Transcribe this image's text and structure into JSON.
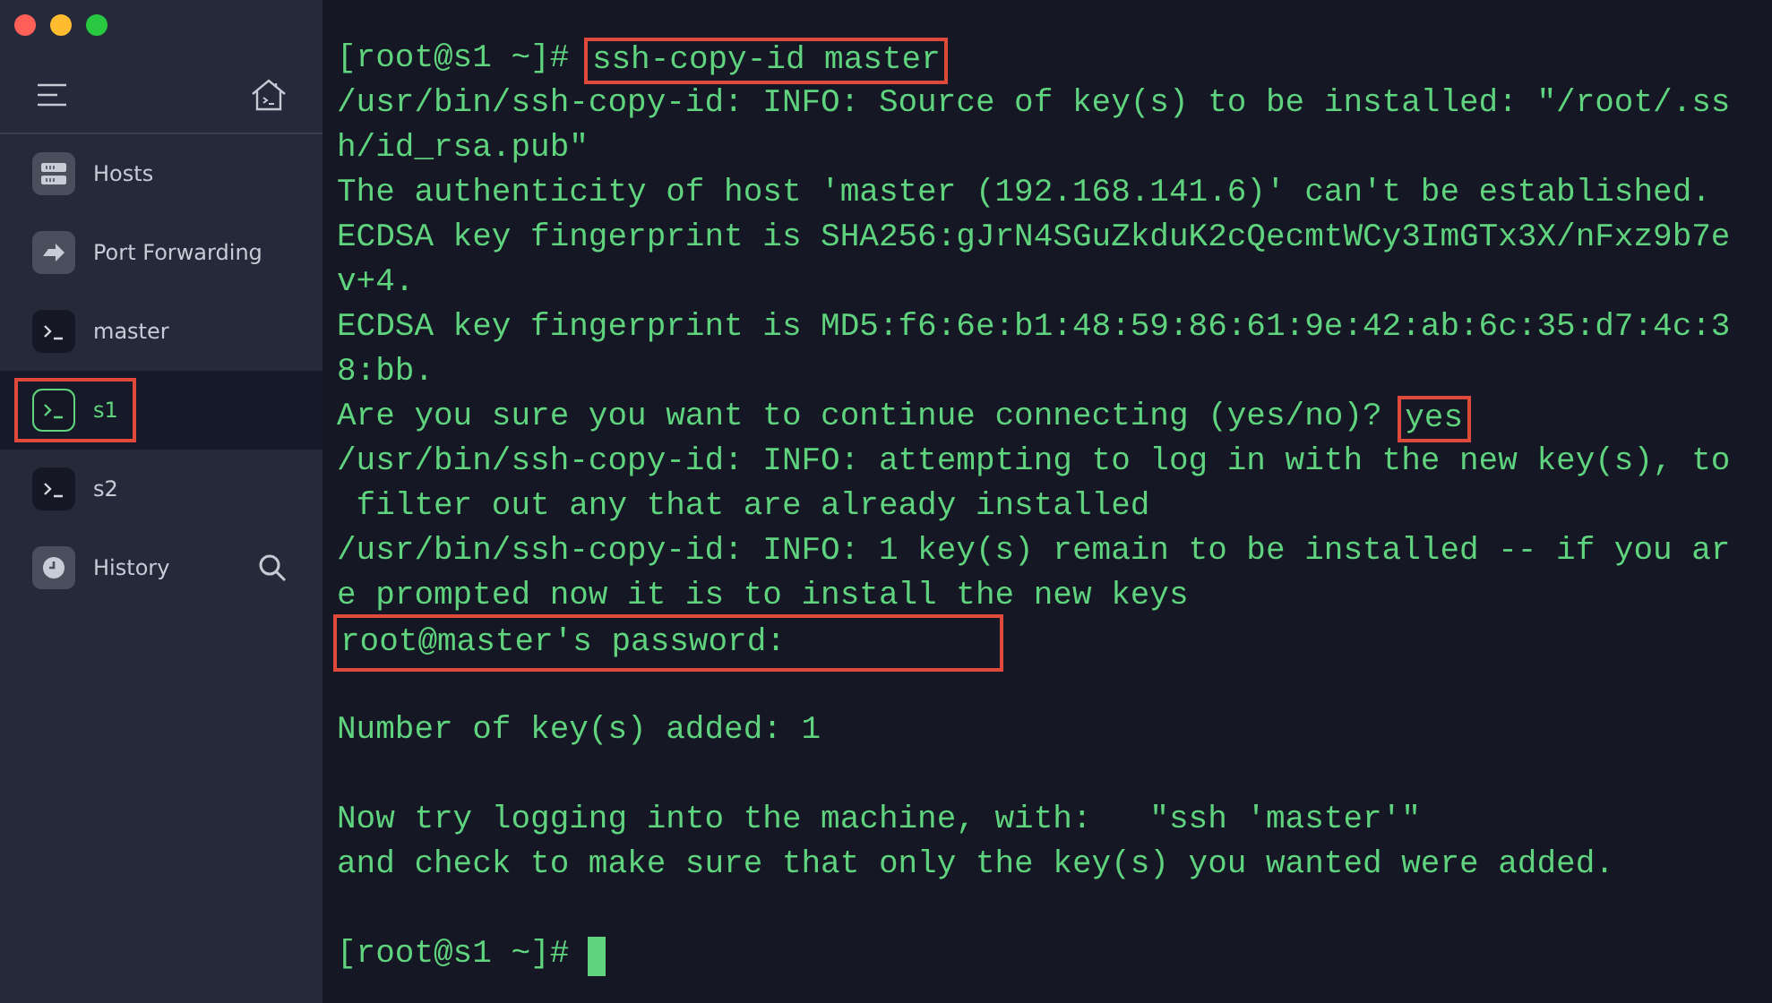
{
  "sidebar": {
    "items": [
      {
        "label": "Hosts",
        "kind": "hosts",
        "selected": false,
        "boxed": false
      },
      {
        "label": "Port Forwarding",
        "kind": "forward",
        "selected": false,
        "boxed": false
      },
      {
        "label": "master",
        "kind": "terminal",
        "selected": false,
        "boxed": false
      },
      {
        "label": "s1",
        "kind": "terminal",
        "selected": true,
        "boxed": true
      },
      {
        "label": "s2",
        "kind": "terminal",
        "selected": false,
        "boxed": false
      },
      {
        "label": "History",
        "kind": "history",
        "selected": false,
        "boxed": false
      }
    ]
  },
  "terminal": {
    "lines": [
      {
        "kind": "text",
        "segments": [
          {
            "kind": "plain",
            "text": "[root@s1 ~]# "
          },
          {
            "kind": "boxed",
            "text": "ssh-copy-id master"
          }
        ]
      },
      {
        "kind": "text",
        "segments": [
          {
            "kind": "plain",
            "text": "/usr/bin/ssh-copy-id: INFO: Source of key(s) to be installed: \"/root/.ss"
          }
        ]
      },
      {
        "kind": "text",
        "segments": [
          {
            "kind": "plain",
            "text": "h/id_rsa.pub\""
          }
        ]
      },
      {
        "kind": "text",
        "segments": [
          {
            "kind": "plain",
            "text": "The authenticity of host 'master (192.168.141.6)' can't be established."
          }
        ]
      },
      {
        "kind": "text",
        "segments": [
          {
            "kind": "plain",
            "text": "ECDSA key fingerprint is SHA256:gJrN4SGuZkduK2cQecmtWCy3ImGTx3X/nFxz9b7e"
          }
        ]
      },
      {
        "kind": "text",
        "segments": [
          {
            "kind": "plain",
            "text": "v+4."
          }
        ]
      },
      {
        "kind": "text",
        "segments": [
          {
            "kind": "plain",
            "text": "ECDSA key fingerprint is MD5:f6:6e:b1:48:59:86:61:9e:42:ab:6c:35:d7:4c:3"
          }
        ]
      },
      {
        "kind": "text",
        "segments": [
          {
            "kind": "plain",
            "text": "8:bb."
          }
        ]
      },
      {
        "kind": "text",
        "segments": [
          {
            "kind": "plain",
            "text": "Are you sure you want to continue connecting (yes/no)? "
          },
          {
            "kind": "boxed",
            "text": "yes"
          }
        ]
      },
      {
        "kind": "text",
        "segments": [
          {
            "kind": "plain",
            "text": "/usr/bin/ssh-copy-id: INFO: attempting to log in with the new key(s), to"
          }
        ]
      },
      {
        "kind": "text",
        "segments": [
          {
            "kind": "plain",
            "text": " filter out any that are already installed"
          }
        ]
      },
      {
        "kind": "text",
        "segments": [
          {
            "kind": "plain",
            "text": "/usr/bin/ssh-copy-id: INFO: 1 key(s) remain to be installed -- if you ar"
          }
        ]
      },
      {
        "kind": "text",
        "segments": [
          {
            "kind": "plain",
            "text": "e prompted now it is to install the new keys"
          }
        ]
      },
      {
        "kind": "text",
        "segments": [
          {
            "kind": "boxed-wide",
            "text": "root@master's password:"
          }
        ]
      },
      {
        "kind": "blank"
      },
      {
        "kind": "text",
        "segments": [
          {
            "kind": "plain",
            "text": "Number of key(s) added: 1"
          }
        ]
      },
      {
        "kind": "blank"
      },
      {
        "kind": "text",
        "segments": [
          {
            "kind": "plain",
            "text": "Now try logging into the machine, with:   \"ssh 'master'\""
          }
        ]
      },
      {
        "kind": "text",
        "segments": [
          {
            "kind": "plain",
            "text": "and check to make sure that only the key(s) you wanted were added."
          }
        ]
      },
      {
        "kind": "blank"
      },
      {
        "kind": "prompt",
        "segments": [
          {
            "kind": "plain",
            "text": "[root@s1 ~]# "
          }
        ]
      }
    ]
  }
}
